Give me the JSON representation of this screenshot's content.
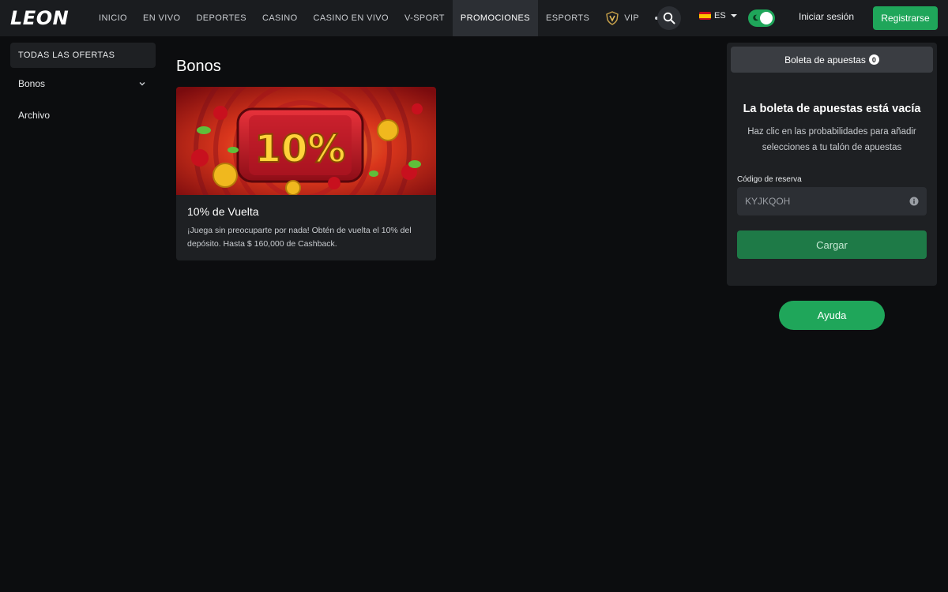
{
  "header": {
    "logo": "LEON",
    "nav": [
      {
        "label": "INICIO"
      },
      {
        "label": "EN VIVO"
      },
      {
        "label": "DEPORTES"
      },
      {
        "label": "CASINO"
      },
      {
        "label": "CASINO EN VIVO"
      },
      {
        "label": "V-SPORT"
      },
      {
        "label": "PROMOCIONES",
        "active": true
      },
      {
        "label": "ESPORTS"
      },
      {
        "label": "VIP",
        "icon": "vip-shield-icon"
      }
    ],
    "more_icon": "more-dots-icon",
    "search_icon": "search-icon",
    "language": "ES",
    "language_flag": "spain-flag-icon",
    "theme_toggle_icon": "moon-icon",
    "login_label": "Iniciar sesión",
    "register_label": "Registrarse"
  },
  "sidebar": {
    "all_offers": "TODAS LAS OFERTAS",
    "items": [
      {
        "label": "Bonos",
        "icon": "chevron-down-icon"
      },
      {
        "label": "Archivo"
      }
    ]
  },
  "main": {
    "title": "Bonos",
    "promos": [
      {
        "image_text": "10%",
        "title": "10% de Vuelta",
        "description": "¡Juega sin preocuparte por nada! Obtén de vuelta el 10% del depósito. Hasta $ 160,000 de Cashback."
      }
    ]
  },
  "betslip": {
    "tab_label": "Boleta de apuestas",
    "count": "0",
    "empty_title": "La boleta de apuestas está vacía",
    "empty_desc": "Haz clic en las probabilidades para añadir selecciones a tu talón de apuestas",
    "code_label": "Código de reserva",
    "code_placeholder": "KYJKQOH",
    "info_icon": "info-icon",
    "load_label": "Cargar"
  },
  "help_label": "Ayuda",
  "colors": {
    "background": "#0c0d0f",
    "header": "#1a1c1f",
    "panel": "#1e2023",
    "accent_green": "#1fa65a",
    "load_green": "#1e7a47"
  }
}
